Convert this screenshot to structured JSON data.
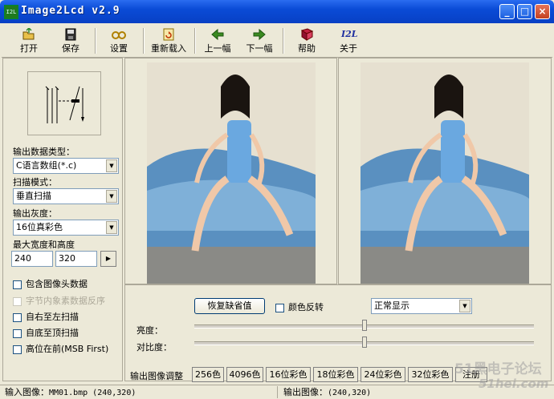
{
  "window": {
    "title": "Image2Lcd v2.9",
    "icon_text": "I2L"
  },
  "toolbar": {
    "items": [
      {
        "label": "打开",
        "icon": "open-icon"
      },
      {
        "label": "保存",
        "icon": "save-icon"
      },
      {
        "label": "设置",
        "icon": "settings-icon"
      },
      {
        "label": "重新载入",
        "icon": "reload-icon"
      },
      {
        "label": "上一幅",
        "icon": "prev-arrow-icon"
      },
      {
        "label": "下一幅",
        "icon": "next-arrow-icon"
      },
      {
        "label": "帮助",
        "icon": "help-book-icon"
      },
      {
        "label": "关于",
        "icon": "about-icon",
        "icon_text": "I2L"
      }
    ]
  },
  "left": {
    "output_type_label": "输出数据类型：",
    "output_type_value": "C语言数组(*.c)",
    "scan_mode_label": "扫描模式：",
    "scan_mode_value": "垂直扫描",
    "gray_label": "输出灰度：",
    "gray_value": "16位真彩色",
    "max_size_label": "最大宽度和高度",
    "max_width": "240",
    "max_height": "320",
    "options": [
      {
        "label": "包含图像头数据",
        "checked": false,
        "disabled": false
      },
      {
        "label": "字节内象素数据反序",
        "checked": false,
        "disabled": true
      },
      {
        "label": "自右至左扫描",
        "checked": false,
        "disabled": false
      },
      {
        "label": "自底至顶扫描",
        "checked": false,
        "disabled": false
      },
      {
        "label": "高位在前(MSB First)",
        "checked": false,
        "disabled": false
      }
    ]
  },
  "bottom": {
    "restore_label": "恢复缺省值",
    "invert_label": "颜色反转",
    "display_mode": "正常显示",
    "brightness_label": "亮度：",
    "contrast_label": "对比度：",
    "brightness_level": 0.5,
    "contrast_level": 0.5,
    "adjust_label": "输出图像调整",
    "color_buttons": [
      "256色",
      "4096色",
      "16位彩色",
      "18位彩色",
      "24位彩色",
      "32位彩色",
      "注册"
    ]
  },
  "status": {
    "input_label": "输入图像：",
    "input_value": "MM01.bmp (240,320)",
    "output_label": "输出图像：",
    "output_value": "(240,320)"
  },
  "watermark": {
    "line1": "51黑电子论坛",
    "line2": "51hei.com"
  },
  "colors": {
    "titlebar": "#0a4bd6",
    "face": "#ece9d8",
    "border": "#aca899"
  }
}
